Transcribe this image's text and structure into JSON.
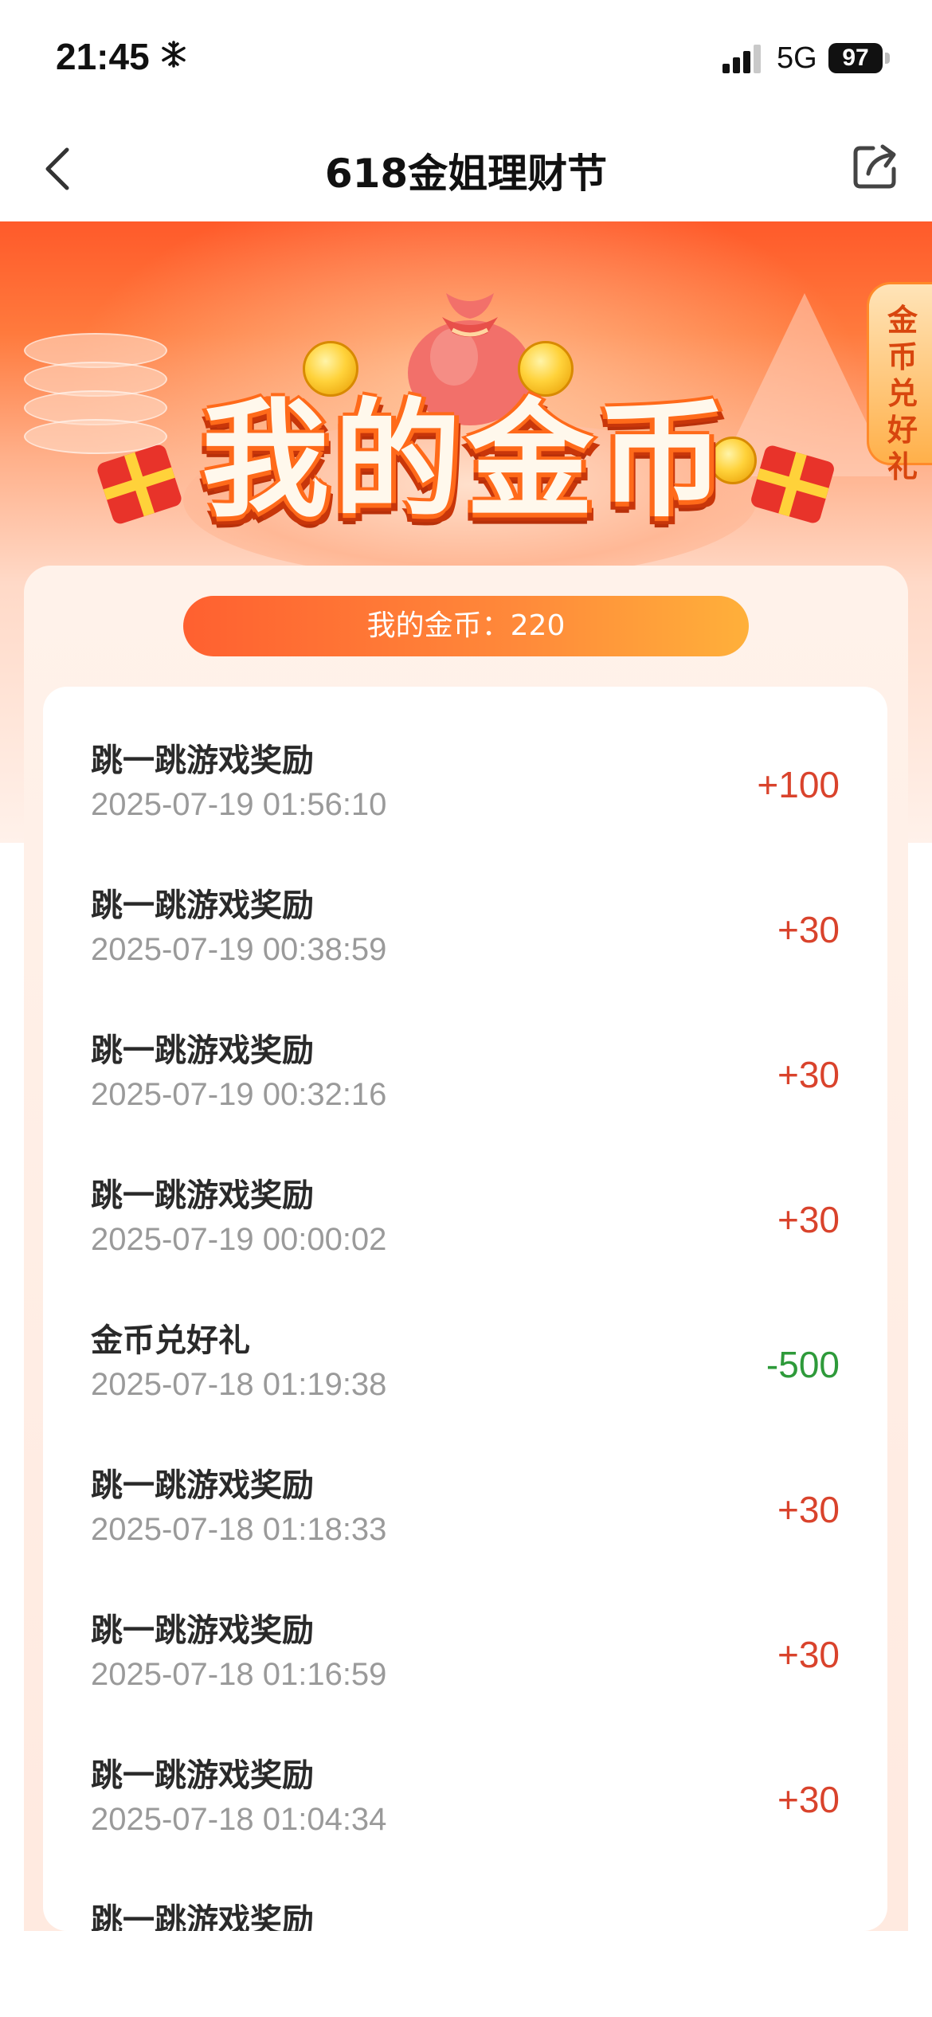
{
  "status_bar": {
    "time": "21:45",
    "network": "5G",
    "battery": "97"
  },
  "nav": {
    "title": "618金姐理财节"
  },
  "hero": {
    "title": "我的金币"
  },
  "side_tab": {
    "label": "金币兑好礼"
  },
  "balance": {
    "label": "我的金币：220"
  },
  "colors": {
    "positive": "#d9432c",
    "negative": "#2e9a3a",
    "accent": "#ff6a30"
  },
  "records": [
    {
      "title": "跳一跳游戏奖励",
      "time": "2025-07-19 01:56:10",
      "amount": "+100",
      "type": "positive"
    },
    {
      "title": "跳一跳游戏奖励",
      "time": "2025-07-19 00:38:59",
      "amount": "+30",
      "type": "positive"
    },
    {
      "title": "跳一跳游戏奖励",
      "time": "2025-07-19 00:32:16",
      "amount": "+30",
      "type": "positive"
    },
    {
      "title": "跳一跳游戏奖励",
      "time": "2025-07-19 00:00:02",
      "amount": "+30",
      "type": "positive"
    },
    {
      "title": "金币兑好礼",
      "time": "2025-07-18 01:19:38",
      "amount": "-500",
      "type": "negative"
    },
    {
      "title": "跳一跳游戏奖励",
      "time": "2025-07-18 01:18:33",
      "amount": "+30",
      "type": "positive"
    },
    {
      "title": "跳一跳游戏奖励",
      "time": "2025-07-18 01:16:59",
      "amount": "+30",
      "type": "positive"
    },
    {
      "title": "跳一跳游戏奖励",
      "time": "2025-07-18 01:04:34",
      "amount": "+30",
      "type": "positive"
    },
    {
      "title": "跳一跳游戏奖励",
      "time": "",
      "amount": "",
      "type": "positive"
    }
  ],
  "icons": {
    "status_flake": "snowflake-icon",
    "status_signal": "signal-icon",
    "back": "chevron-left-icon",
    "share": "share-icon"
  }
}
